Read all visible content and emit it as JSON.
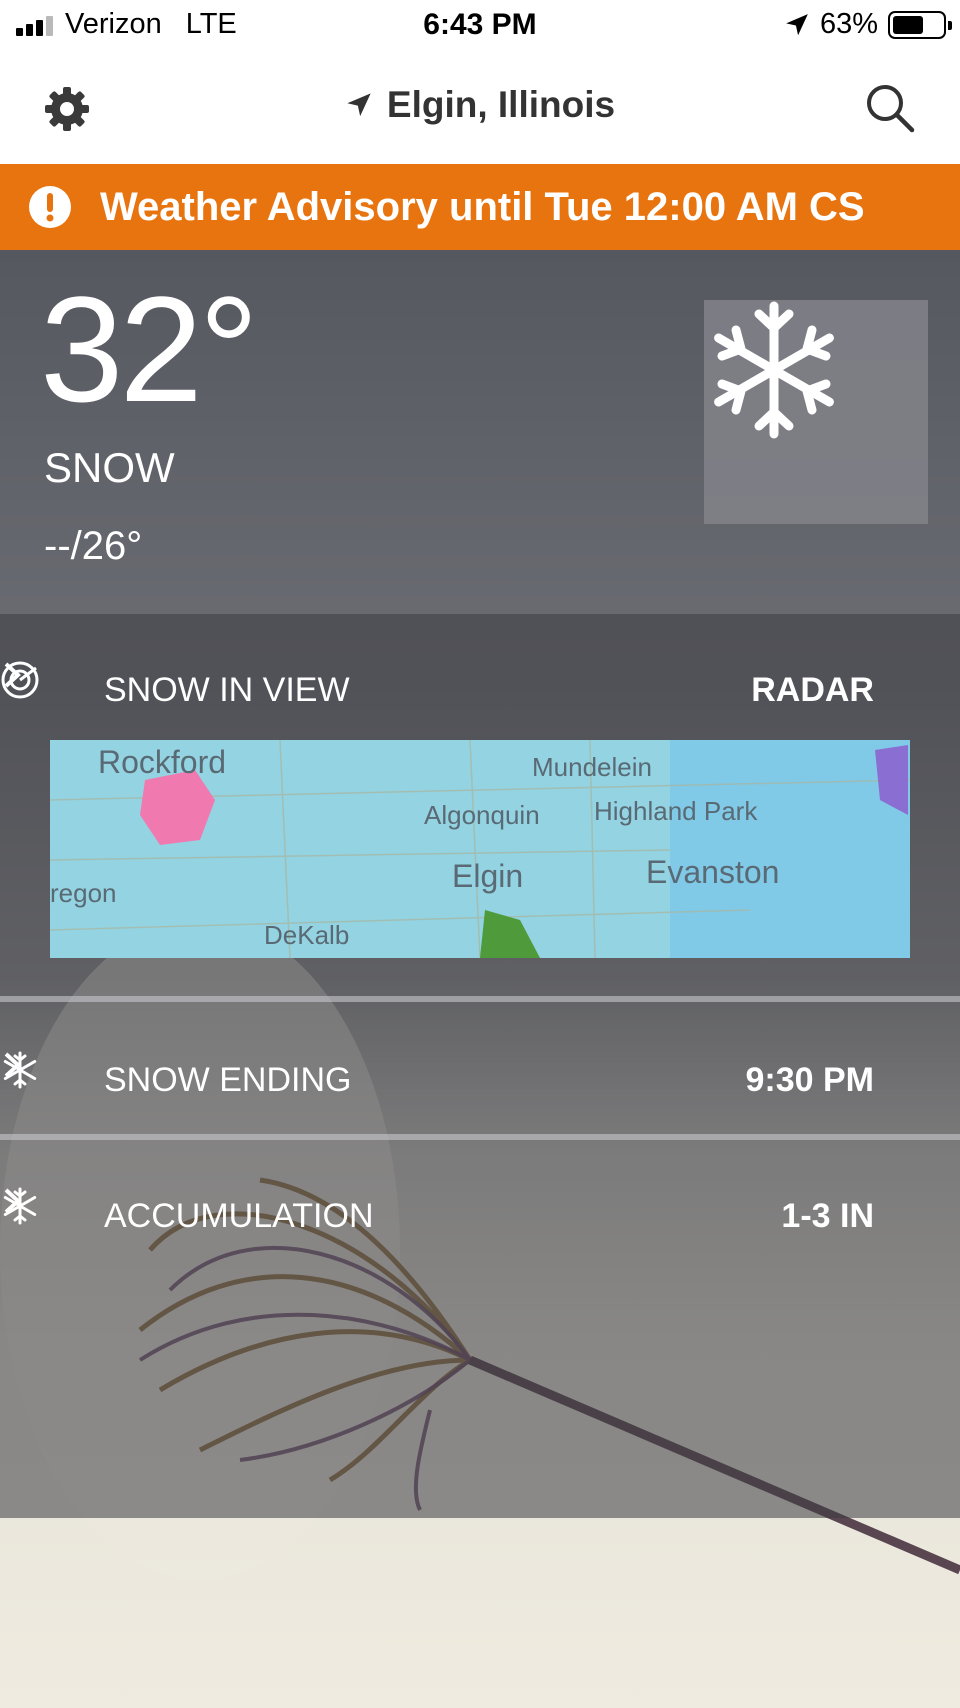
{
  "status_bar": {
    "carrier": "Verizon",
    "network": "LTE",
    "time": "6:43 PM",
    "battery_text": "63%",
    "battery_level": 0.63
  },
  "nav": {
    "location": "Elgin, Illinois"
  },
  "alert": {
    "text": "Weather Advisory until Tue 12:00 AM CS"
  },
  "current": {
    "temperature": "32°",
    "condition": "SNOW",
    "hi_lo": "--/26°",
    "icon": "snowflake-icon"
  },
  "rows": {
    "radar": {
      "label": "SNOW IN VIEW",
      "value": "RADAR",
      "icon": "radar-icon"
    },
    "ending": {
      "label": "SNOW ENDING",
      "value": "9:30 PM",
      "icon": "snowflake-icon"
    },
    "accumulation": {
      "label": "ACCUMULATION",
      "value": "1-3 IN",
      "icon": "snowflake-icon"
    }
  },
  "map": {
    "labels": {
      "rockford": "Rockford",
      "mundelein": "Mundelein",
      "algonquin": "Algonquin",
      "highland_park": "Highland Park",
      "elgin": "Elgin",
      "evanston": "Evanston",
      "oregon": "regon",
      "dekalb": "DeKalb"
    }
  },
  "colors": {
    "alert": "#e8740f",
    "map_water": "#8fd2e4",
    "snow_pink": "#f07ab0",
    "rain_green": "#4f9a3a"
  }
}
